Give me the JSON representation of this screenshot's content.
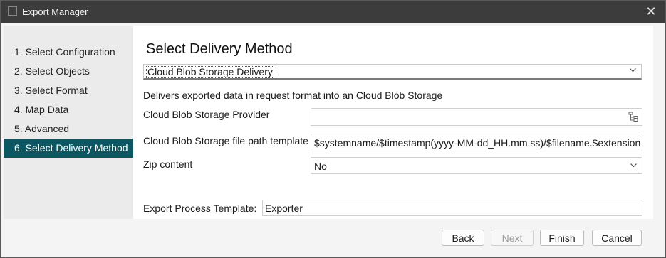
{
  "window": {
    "title": "Export Manager"
  },
  "steps": [
    {
      "label": "1. Select Configuration"
    },
    {
      "label": "2. Select Objects"
    },
    {
      "label": "3. Select Format"
    },
    {
      "label": "4. Map Data"
    },
    {
      "label": "5. Advanced"
    },
    {
      "label": "6. Select Delivery Method",
      "active": true
    }
  ],
  "main": {
    "heading": "Select Delivery Method",
    "delivery_method": "Cloud Blob Storage Delivery",
    "description": "Delivers exported data in request format into an Cloud Blob Storage",
    "provider": {
      "label": "Cloud Blob Storage Provider",
      "value": ""
    },
    "path_template": {
      "label": "Cloud Blob Storage file path template",
      "value": "$systemname/$timestamp(yyyy-MM-dd_HH.mm.ss)/$filename.$extension"
    },
    "zip": {
      "label": "Zip content",
      "value": "No"
    },
    "process_template": {
      "label": "Export Process Template:",
      "value": "Exporter"
    }
  },
  "footer": {
    "back": "Back",
    "next": "Next",
    "finish": "Finish",
    "cancel": "Cancel"
  },
  "colors": {
    "titlebar": "#3c3c3c",
    "active_step": "#0b5661",
    "accent": "#2fa8b8"
  }
}
